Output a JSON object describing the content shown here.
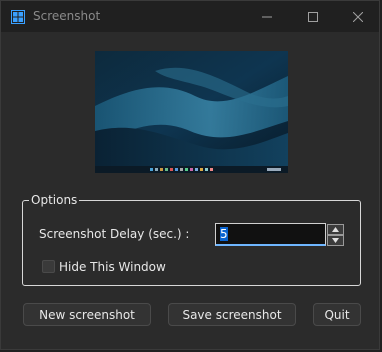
{
  "window": {
    "title": "Screenshot",
    "controls": {
      "minimize": "minimize-icon",
      "maximize": "maximize-icon",
      "close": "close-icon"
    }
  },
  "options": {
    "legend": "Options",
    "delay_label": "Screenshot Delay (sec.) :",
    "delay_value": "5",
    "hide_window_label": "Hide This Window",
    "hide_window_checked": false
  },
  "buttons": {
    "new_screenshot": "New screenshot",
    "save_screenshot": "Save screenshot",
    "quit": "Quit"
  },
  "colors": {
    "background": "#2b2b2b",
    "titlebar": "#202020",
    "input_accent": "#6fb6ff",
    "app_icon": "#3aa0ff"
  }
}
